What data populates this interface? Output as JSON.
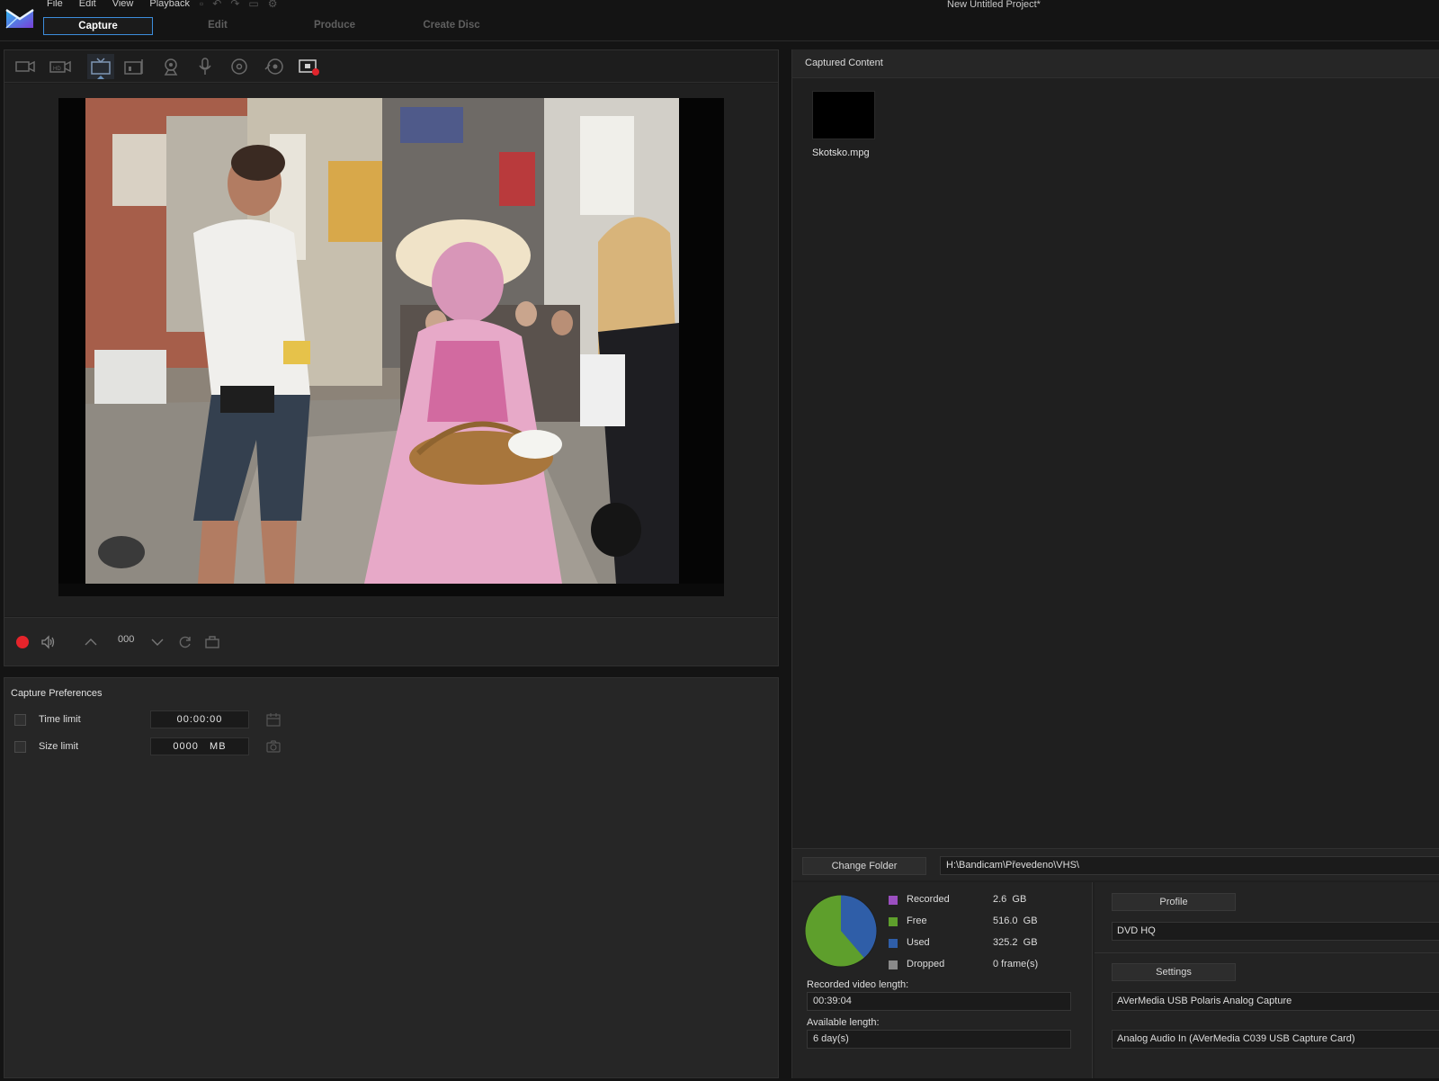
{
  "window": {
    "title": "New Untitled Project*"
  },
  "menu": [
    "File",
    "Edit",
    "View",
    "Playback"
  ],
  "mode_tabs": [
    "Capture",
    "Edit",
    "Produce",
    "Create Disc"
  ],
  "active_mode": "Capture",
  "toolbar": {
    "tools": [
      "capture-from-dv-icon",
      "capture-from-hdv-icon",
      "capture-from-tv-icon",
      "capture-from-digital-tv-icon",
      "capture-from-webcam-icon",
      "capture-from-microphone-icon",
      "capture-from-cd-icon",
      "capture-from-dvd-icon",
      "screen-recorder-icon"
    ],
    "active_tool": "capture-from-tv-icon"
  },
  "player_controls": {
    "counter": "000"
  },
  "capture_preferences": {
    "title": "Capture Preferences",
    "time_limit_label": "Time limit",
    "time_limit_value": "00:00:00",
    "size_limit_label": "Size limit",
    "size_limit_value": "0000   MB"
  },
  "captured_content": {
    "title": "Captured Content",
    "clips": [
      {
        "name": "Skotsko.mpg"
      }
    ]
  },
  "folder": {
    "change_label": "Change Folder",
    "path": "H:\\Bandicam\\Převedeno\\VHS\\"
  },
  "disk": {
    "legend": [
      {
        "label": "Recorded",
        "value": "2.6  GB",
        "color": "#9b4fc0"
      },
      {
        "label": "Free",
        "value": "516.0  GB",
        "color": "#5e9f2c"
      },
      {
        "label": "Used",
        "value": "325.2  GB",
        "color": "#2f5ea8"
      },
      {
        "label": "Dropped",
        "value": "0 frame(s)",
        "color": "#8a8a8a"
      }
    ],
    "pie": {
      "used_fraction": 0.387,
      "free_fraction": 0.613
    },
    "recorded_length_label": "Recorded video length:",
    "recorded_length": "00:39:04",
    "available_length_label": "Available length:",
    "available_length": "6 day(s)"
  },
  "profile": {
    "profile_label": "Profile",
    "profile_value": "DVD HQ",
    "settings_label": "Settings",
    "video_device": "AVerMedia USB Polaris Analog Capture",
    "audio_device": "Analog Audio In (AVerMedia C039 USB Capture Card)"
  }
}
